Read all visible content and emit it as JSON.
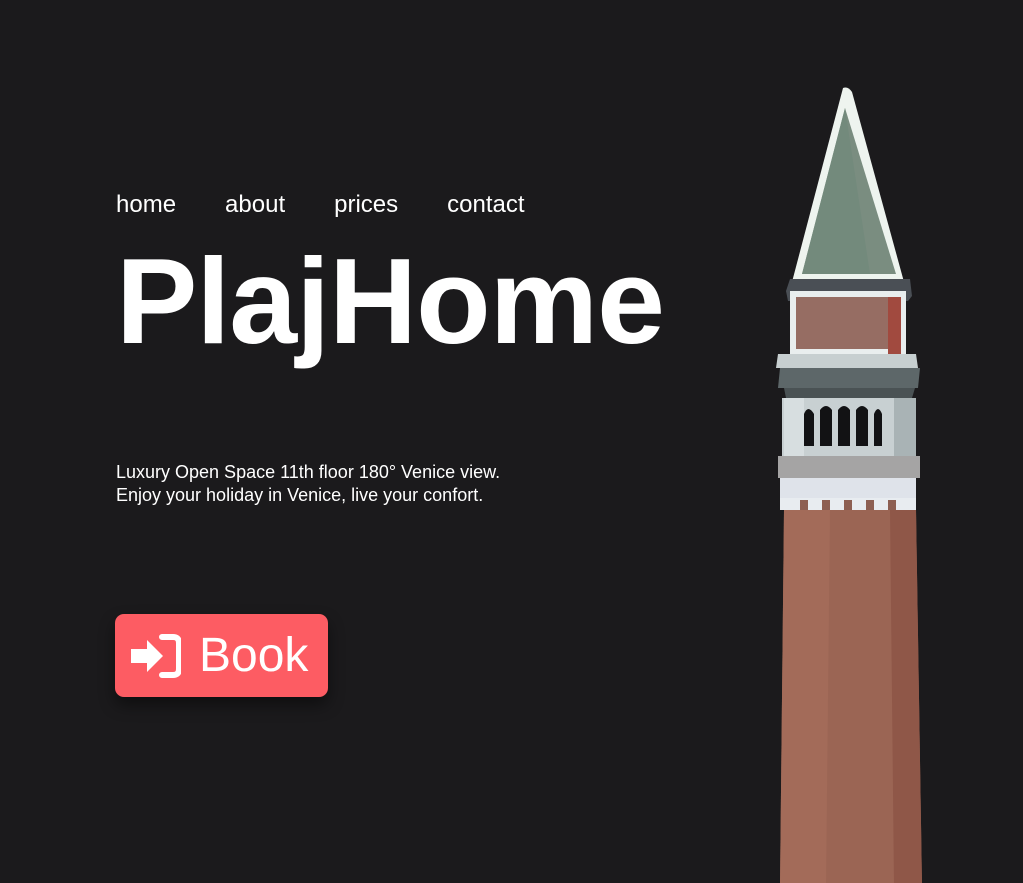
{
  "nav": {
    "items": [
      {
        "label": "home"
      },
      {
        "label": "about"
      },
      {
        "label": "prices"
      },
      {
        "label": "contact"
      }
    ]
  },
  "hero": {
    "title": "PlajHome",
    "description": "Luxury Open Space 11th floor 180° Venice view. Enjoy your holiday in Venice, live your confort.",
    "book_button": {
      "label": "Book",
      "icon": "sign-in-icon"
    }
  },
  "illustration": {
    "name": "bell-tower-illustration"
  },
  "colors": {
    "background": "#1b1a1c",
    "accent": "#fd5c63",
    "text": "#ffffff"
  }
}
